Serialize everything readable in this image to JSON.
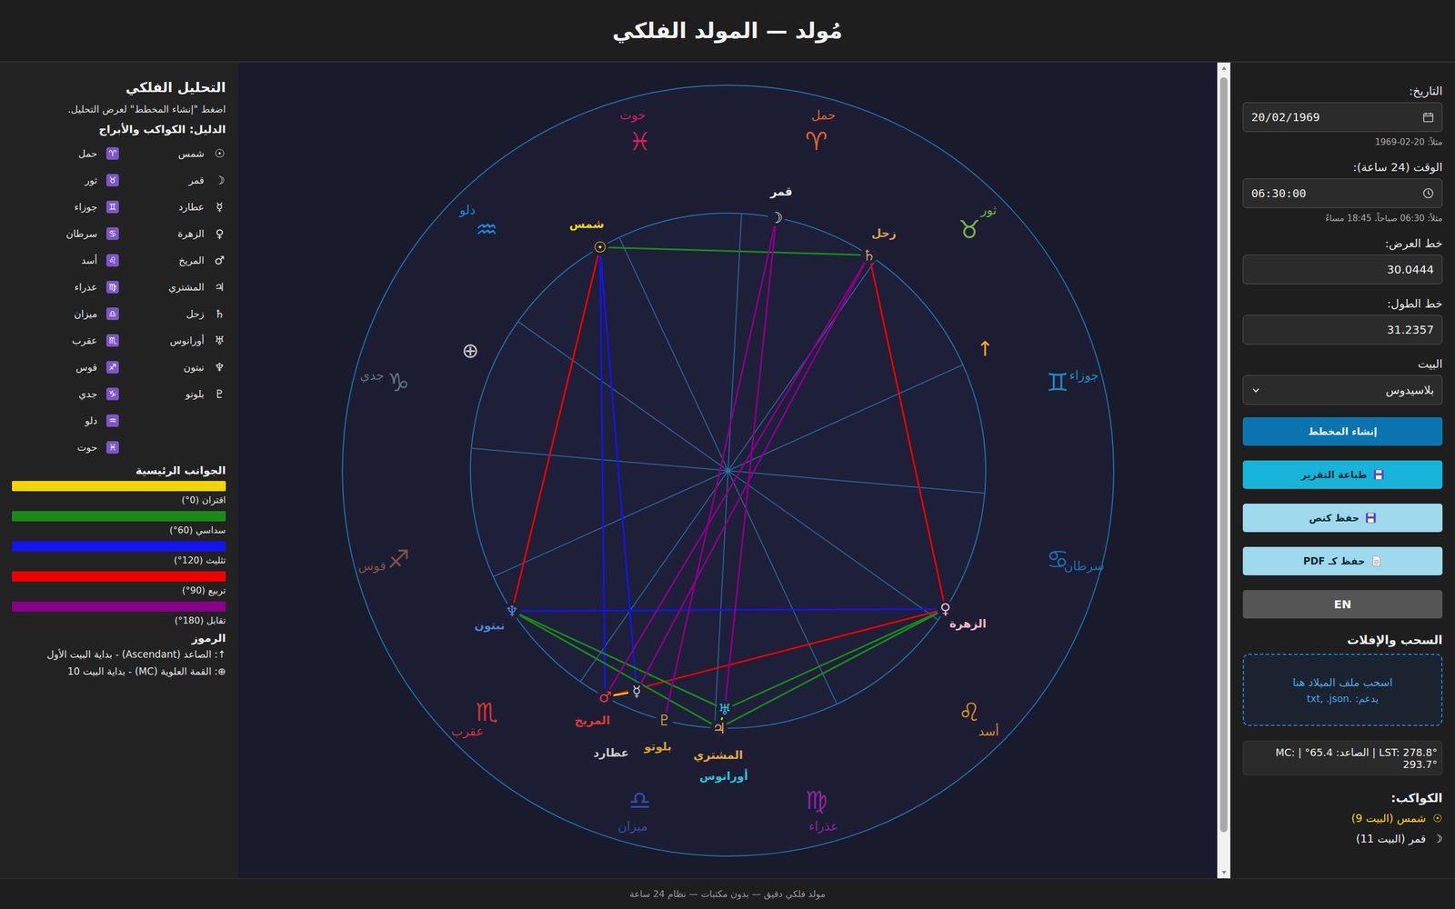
{
  "header": {
    "title": "مُولد — المولد الفلكي"
  },
  "form": {
    "fields": [
      {
        "label": "التاريخ:",
        "value": "20/02/1969",
        "hint": "مثلاً: 20-02-1969",
        "kind": "date"
      },
      {
        "label": "الوقت (24 ساعة):",
        "value": "06:30:00",
        "hint": "مثلاً: 06:30 صباحاً، 18:45 مساءً",
        "kind": "time"
      },
      {
        "label": "خط العرض:",
        "value": "30.0444",
        "kind": "number"
      },
      {
        "label": "خط الطول:",
        "value": "31.2357",
        "kind": "number"
      },
      {
        "label": "البيت",
        "value": "بلاسيدوس",
        "kind": "select"
      }
    ],
    "buttons": [
      {
        "label": "إنشاء المخطط",
        "kind": "primary"
      },
      {
        "label": "طباعة التقرير",
        "kind": "print"
      },
      {
        "label": "حفظ كنص",
        "kind": "save"
      },
      {
        "label": "حفظ كـ PDF",
        "kind": "pdf"
      },
      {
        "label": "EN",
        "kind": "lang"
      }
    ]
  },
  "dropzone": {
    "heading": "السحب والإفلات",
    "text": "اسحب ملف الميلاد هنا",
    "hint": "يدعم: .txt, .json"
  },
  "info": "LST: 278.8° | الصاعد: 65.4° | MC: 293.7°",
  "planets_list": {
    "heading": "الكواكب:",
    "items": [
      {
        "symbol": "☉",
        "text": "شمس (البيت 9)",
        "color": "#ffd700"
      },
      {
        "symbol": "☽",
        "text": "قمر (البيت 11)",
        "color": "#f0f0f0"
      }
    ]
  },
  "scrollbar": {
    "level": 0.96
  },
  "chart": {
    "signs": [
      {
        "symbol": "♈",
        "name": "حمل",
        "color": "#ff6a2a",
        "angle": 75
      },
      {
        "symbol": "♉",
        "name": "ثور",
        "color": "#8bc34a",
        "angle": 45
      },
      {
        "symbol": "♊",
        "name": "جوزاء",
        "color": "#1e9ad6",
        "angle": 15
      },
      {
        "symbol": "♋",
        "name": "سرطان",
        "color": "#1f7ab8",
        "angle": -15
      },
      {
        "symbol": "♌",
        "name": "أسد",
        "color": "#f0a020",
        "angle": -45
      },
      {
        "symbol": "♍",
        "name": "عذراء",
        "color": "#9c27b0",
        "angle": -75
      },
      {
        "symbol": "♎",
        "name": "ميزان",
        "color": "#3f51b5",
        "angle": -105
      },
      {
        "symbol": "♏",
        "name": "عقرب",
        "color": "#e53935",
        "angle": -135
      },
      {
        "symbol": "♐",
        "name": "قوس",
        "color": "#8d5a45",
        "angle": -165
      },
      {
        "symbol": "♑",
        "name": "جدي",
        "color": "#6d7b8a",
        "angle": 165
      },
      {
        "symbol": "♒",
        "name": "دلو",
        "color": "#2196f3",
        "angle": 135
      },
      {
        "symbol": "♓",
        "name": "حوت",
        "color": "#e91e63",
        "angle": 105
      }
    ],
    "houses": [
      24.3,
      55,
      87,
      115,
      144.6,
      175,
      204.3,
      235,
      267,
      295,
      324.6,
      355
    ],
    "markers": [
      {
        "symbol": "↑",
        "angle": 25.4,
        "color": "#f5a623"
      },
      {
        "symbol": "⊕",
        "angle": 155,
        "color": "#c8c8c8"
      }
    ],
    "planets": [
      {
        "symbol": "☉",
        "label": "شمس",
        "color": "#ffd700",
        "angle": 119.8
      },
      {
        "symbol": "☽",
        "label": "قمر",
        "color": "#e8e8e8",
        "angle": 79.2
      },
      {
        "symbol": "☿",
        "label": "عطارد",
        "color": "#c8c8c8",
        "angle": 247.5
      },
      {
        "symbol": "♀",
        "label": "الزهرة",
        "color": "#f4b8c8",
        "angle": 327.5
      },
      {
        "symbol": "♂",
        "label": "المريخ",
        "color": "#e53935",
        "angle": 241.5
      },
      {
        "symbol": "♃",
        "label": "المشتري",
        "color": "#e8a93a",
        "angle": 268.0
      },
      {
        "symbol": "♄",
        "label": "زحل",
        "color": "#d4a055",
        "angle": 56.8
      },
      {
        "symbol": "♅",
        "label": "أورانوس",
        "color": "#26c6da",
        "angle": 269.2
      },
      {
        "symbol": "♆",
        "label": "نبتون",
        "color": "#4a86d8",
        "angle": 213.0
      },
      {
        "symbol": "♇",
        "label": "بلوتو",
        "color": "#d4a030",
        "angle": 255.7
      }
    ],
    "aspects": [
      {
        "from": 0,
        "to": 6,
        "aspect": 1
      },
      {
        "from": 0,
        "to": 8,
        "aspect": 3
      },
      {
        "from": 0,
        "to": 4,
        "aspect": 2
      },
      {
        "from": 0,
        "to": 2,
        "aspect": 2
      },
      {
        "from": 6,
        "to": 3,
        "aspect": 3
      },
      {
        "from": 3,
        "to": 8,
        "aspect": 2
      },
      {
        "from": 3,
        "to": 4,
        "aspect": 3
      },
      {
        "from": 3,
        "to": 7,
        "aspect": 1
      },
      {
        "from": 3,
        "to": 5,
        "aspect": 1
      },
      {
        "from": 8,
        "to": 7,
        "aspect": 1
      },
      {
        "from": 8,
        "to": 5,
        "aspect": 1
      },
      {
        "from": 1,
        "to": 9,
        "aspect": 4
      },
      {
        "from": 1,
        "to": 7,
        "aspect": 4
      },
      {
        "from": 6,
        "to": 4,
        "aspect": 4
      },
      {
        "from": 6,
        "to": 2,
        "aspect": 4
      },
      {
        "from": 4,
        "to": 2,
        "aspect": 0
      },
      {
        "from": 5,
        "to": 7,
        "aspect": 0
      }
    ]
  },
  "analysis": {
    "title": "التحليل الفلكي",
    "instruction": "اضغط \"إنشاء المخطط\" لعرض التحليل.",
    "legend_heading": "الدليل: الكواكب والأبراج",
    "planets": [
      {
        "symbol": "☉",
        "name": "شمس"
      },
      {
        "symbol": "☽",
        "name": "قمر"
      },
      {
        "symbol": "☿",
        "name": "عطارد"
      },
      {
        "symbol": "♀",
        "name": "الزهرة"
      },
      {
        "symbol": "♂",
        "name": "المريخ"
      },
      {
        "symbol": "♃",
        "name": "المشتري"
      },
      {
        "symbol": "♄",
        "name": "زحل"
      },
      {
        "symbol": "♅",
        "name": "أورانوس"
      },
      {
        "symbol": "♆",
        "name": "نبتون"
      },
      {
        "symbol": "♇",
        "name": "بلوتو"
      }
    ],
    "signs": [
      {
        "symbol": "♈",
        "name": "حمل"
      },
      {
        "symbol": "♉",
        "name": "ثور"
      },
      {
        "symbol": "♊",
        "name": "جوزاء"
      },
      {
        "symbol": "♋",
        "name": "سرطان"
      },
      {
        "symbol": "♌",
        "name": "أسد"
      },
      {
        "symbol": "♍",
        "name": "عذراء"
      },
      {
        "symbol": "♎",
        "name": "ميزان"
      },
      {
        "symbol": "♏",
        "name": "عقرب"
      },
      {
        "symbol": "♐",
        "name": "قوس"
      },
      {
        "symbol": "♑",
        "name": "جدي"
      },
      {
        "symbol": "♒",
        "name": "دلو"
      },
      {
        "symbol": "♓",
        "name": "حوت"
      }
    ],
    "aspects_heading": "الجوانب الرئيسية",
    "aspects": [
      {
        "label": "اقتران (0°)",
        "color": "#f5d400"
      },
      {
        "label": "سداسي (60°)",
        "color": "#1a8a1a"
      },
      {
        "label": "تثليث (120°)",
        "color": "#1414f0"
      },
      {
        "label": "تربيع (90°)",
        "color": "#ee0000"
      },
      {
        "label": "تقابل (180°)",
        "color": "#880088"
      }
    ],
    "symbols_heading": "الرموز",
    "symbols": [
      "↑: الصاعد (Ascendant) - بداية البيت الأول",
      "⊕: القمة العلوية (MC) - بداية البيت 10"
    ]
  },
  "footer": "مولد فلكي دقيق — بدون مكتبات — نظام 24 ساعة"
}
